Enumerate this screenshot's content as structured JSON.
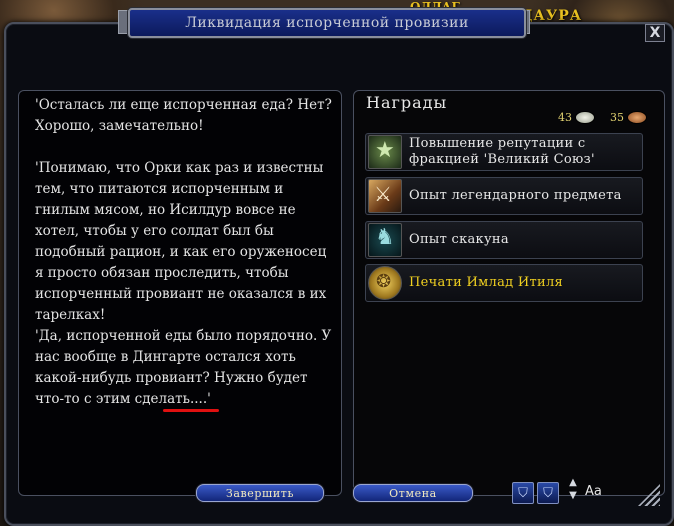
{
  "window": {
    "title": "Ликвидация испорченной провизии",
    "close_label": "X"
  },
  "dialog": {
    "paragraphs": [
      "'Осталась ли еще испорченная еда? Нет? Хорошо, замечательно!",
      "'Понимаю, что Орки как раз и известны тем, что питаются испорченным и гнилым мясом, но Исилдур вовсе не хотел, чтобы у его солдат был бы подобный рацион, и как его оруженосец я просто обязан проследить, чтобы испорченный провиант не оказался в их тарелках!",
      "'Да, испорченной еды было порядочно. У нас вообще в Дингарте остался хоть какой-нибудь провиант? Нужно будет что-то с этим сделать....'"
    ]
  },
  "rewards": {
    "title": "Награды",
    "silver": "43",
    "copper": "35",
    "items": [
      {
        "label": "Повышение репутации с фракцией 'Великий Союз'",
        "icon": "reputation-star-icon"
      },
      {
        "label": "Опыт легендарного предмета",
        "icon": "legendary-item-icon"
      },
      {
        "label": "Опыт скакуна",
        "icon": "mount-horse-icon"
      },
      {
        "label": "Печати Имлад Итиля",
        "icon": "seal-coin-icon",
        "color": "#f0d020"
      }
    ]
  },
  "buttons": {
    "complete": "Завершить",
    "cancel": "Отмена"
  },
  "font_control": {
    "label": "Aa"
  },
  "background": {
    "sign_text": "ДАУРА",
    "sign_text_top": "ОЛЛАГ"
  },
  "colors": {
    "title_bar": "#1a2f8a",
    "button": "#2a48b8",
    "gold_text": "#f0d020",
    "annotation_underline": "#e01010"
  }
}
